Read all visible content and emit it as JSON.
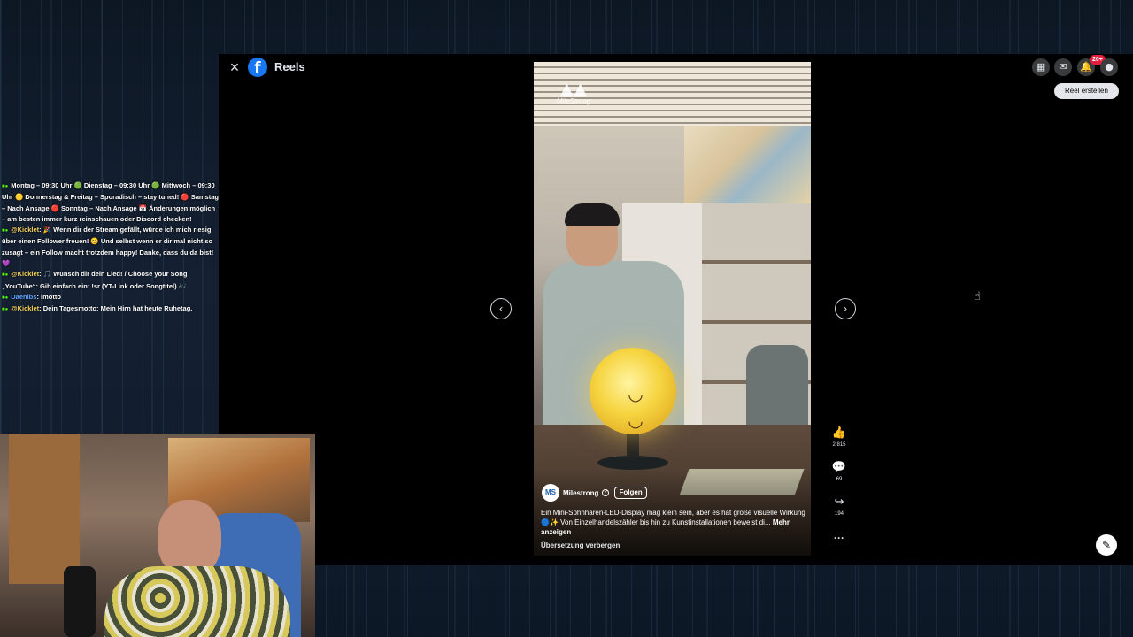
{
  "header": {
    "close_icon": "×",
    "logo_letter": "f",
    "title": "Reels"
  },
  "topbar": {
    "menu_icon": "grid-icon",
    "messenger_icon": "messenger-icon",
    "notifications_icon": "bell-icon",
    "notifications_badge": "20+",
    "profile_icon": "avatar",
    "create_reel_label": "Reel erstellen"
  },
  "video": {
    "watermark_brand": "MileStrong",
    "author_avatar_text": "MS",
    "author_name": "Milestrong",
    "follow_label": "Folgen",
    "caption": "Ein Mini-Sphhhären-LED-Display mag klein sein, aber es hat große visuelle Wirkung 🔵✨ Von Einzelhandelszähler bis hin zu Kunstinstallationen beweist di...",
    "caption_more": "Mehr anzeigen",
    "translation_label": "Übersetzung verbergen"
  },
  "actions": {
    "likes": "2.815",
    "comments": "69",
    "shares": "194"
  },
  "nav": {
    "prev": "‹",
    "next": "›"
  },
  "chat": {
    "lines": [
      {
        "user": "",
        "text": "Montag – 09:30 Uhr 🟢 Dienstag – 09:30 Uhr 🟢 Mittwoch – 09:30 Uhr 🟡 Donnerstag & Freitag – Sporadisch – stay tuned! 🔴 Samstag – Nach Ansage 🔴 Sonntag – Nach Ansage 📅 Änderungen möglich – am besten immer kurz reinschauen oder Discord checken!"
      },
      {
        "user": "@Kicklet",
        "text": ": 🎉 Wenn dir der Stream gefällt, würde ich mich riesig über einen Follower freuen! 😊 Und selbst wenn er dir mal nicht so zusagt – ein Follow macht trotzdem happy! Danke, dass du da bist! 💜"
      },
      {
        "user": "@Kicklet",
        "text": ": 🎵 Wünsch dir dein Lied! / Choose your Song „YouTube“: Gib einfach ein: !sr (YT-Link oder Songtitel) 🎶"
      },
      {
        "user": "Daenibs",
        "text": ": lmotto"
      },
      {
        "user": "@Kicklet",
        "text": ": Dein Tagesmotto: Mein Hirn hat heute Ruhetag."
      }
    ]
  }
}
